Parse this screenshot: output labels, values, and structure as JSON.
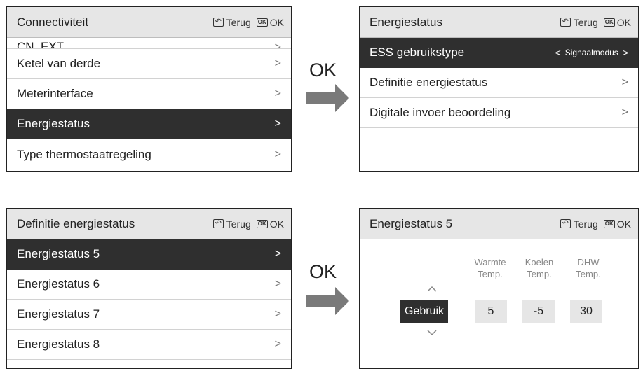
{
  "header_actions": {
    "back_label": "Terug",
    "ok_label": "OK",
    "ok_icon_text": "OK"
  },
  "step_label": "OK",
  "panel1": {
    "title": "Connectiviteit",
    "partial_item": "CN_EXT",
    "items": [
      {
        "label": "Ketel van derde"
      },
      {
        "label": "Meterinterface"
      },
      {
        "label": "Energiestatus",
        "selected": true
      },
      {
        "label": "Type thermostaatregeling"
      }
    ]
  },
  "panel2": {
    "title": "Energiestatus",
    "items": [
      {
        "label": "ESS gebruikstype",
        "value": "Signaalmodus",
        "selected": true
      },
      {
        "label": "Definitie energiestatus"
      },
      {
        "label": "Digitale invoer beoordeling"
      }
    ]
  },
  "panel3": {
    "title": "Definitie energiestatus",
    "items": [
      {
        "label": "Energiestatus 5",
        "selected": true
      },
      {
        "label": "Energiestatus 6"
      },
      {
        "label": "Energiestatus 7"
      },
      {
        "label": "Energiestatus 8"
      }
    ]
  },
  "panel4": {
    "title": "Energiestatus 5",
    "mode": "Gebruik",
    "columns": [
      {
        "line1": "Warmte",
        "line2": "Temp.",
        "value": "5"
      },
      {
        "line1": "Koelen",
        "line2": "Temp.",
        "value": "-5"
      },
      {
        "line1": "DHW",
        "line2": "Temp.",
        "value": "30"
      }
    ]
  },
  "icons": {
    "back": "back-icon",
    "ok": "ok-icon",
    "chevron": "chevron-right-icon",
    "step_arrow": "arrow-right-icon",
    "up": "chevron-up-icon",
    "down": "chevron-down-icon"
  },
  "colors": {
    "selected_bg": "#2f2f2f",
    "header_bg": "#e6e6e6",
    "arrow": "#7a7a7a"
  }
}
